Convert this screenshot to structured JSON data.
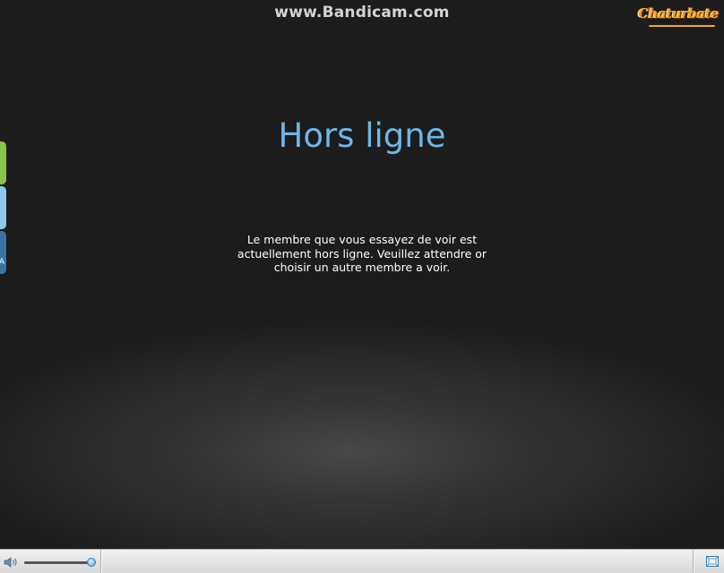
{
  "watermark": {
    "text": "www.Bandicam.com"
  },
  "brand": {
    "logo_text": "Chaturbate",
    "logo_color": "#f6a623"
  },
  "main": {
    "title": "Hors ligne",
    "title_color": "#6db7e8",
    "message": "Le membre que vous essayez de voir est actuellement hors ligne. Veuillez attendre or choisir un autre membre a voir."
  },
  "side_tabs": [
    {
      "icon": "tab-green",
      "color": "#8bc34a"
    },
    {
      "icon": "tab-light-blue",
      "color": "#90c8ee"
    },
    {
      "icon": "tab-dark-blue",
      "color": "#3b73a3",
      "label": "A"
    }
  ],
  "controls": {
    "volume_icon": "speaker-icon",
    "volume_level": 0.97,
    "fullscreen_icon": "fullscreen-icon"
  }
}
